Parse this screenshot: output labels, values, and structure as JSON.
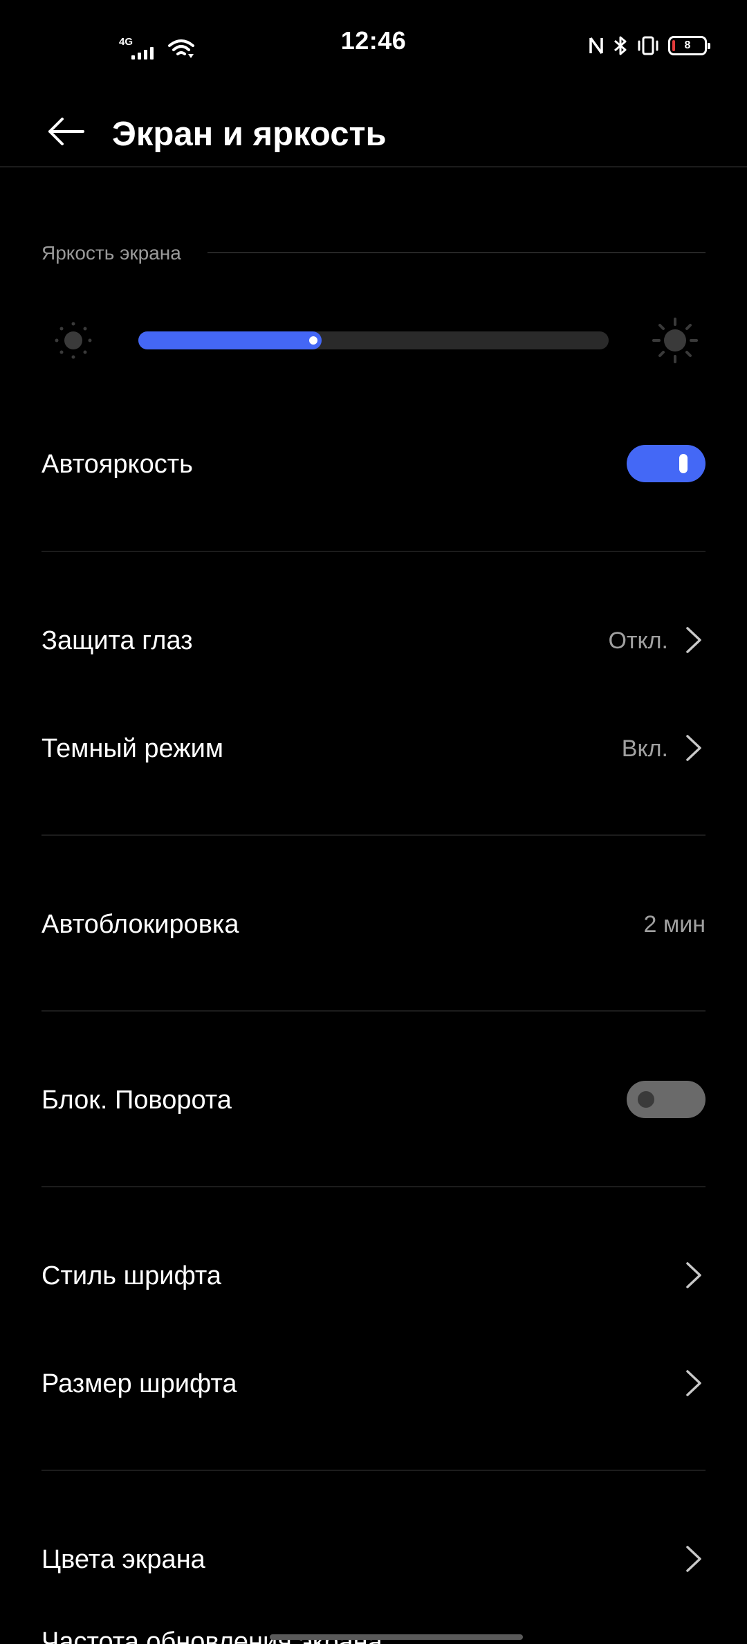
{
  "status_bar": {
    "time": "12:46",
    "network_type": "4G",
    "battery_level": "8",
    "icons": [
      "signal-icon",
      "wifi-icon",
      "nfc-icon",
      "bluetooth-icon",
      "vibrate-icon",
      "battery-icon"
    ]
  },
  "header": {
    "title": "Экран и яркость",
    "back_icon": "arrow-left-icon"
  },
  "brightness": {
    "section_label": "Яркость экрана",
    "level_fraction": 0.39,
    "accent_color": "#4467f5"
  },
  "rows": {
    "auto_brightness": {
      "label": "Автояркость",
      "toggle_on": true
    },
    "eye_protection": {
      "label": "Защита глаз",
      "value": "Откл."
    },
    "dark_mode": {
      "label": "Темный режим",
      "value": "Вкл."
    },
    "auto_lock": {
      "label": "Автоблокировка",
      "value": "2 мин"
    },
    "rotation_lock": {
      "label": "Блок. Поворота",
      "toggle_on": false
    },
    "font_style": {
      "label": "Стиль шрифта"
    },
    "font_size": {
      "label": "Размер шрифта"
    },
    "screen_colors": {
      "label": "Цвета экрана"
    },
    "refresh_rate": {
      "label": "Частота обновления экрана"
    }
  }
}
